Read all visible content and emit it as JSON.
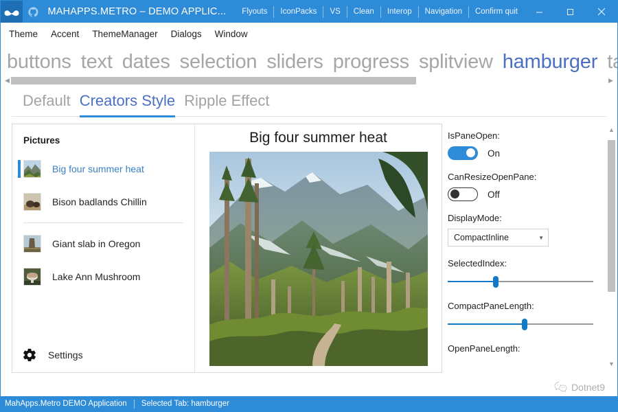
{
  "titlebar": {
    "logo_icon": "mustache-icon",
    "github_icon": "github-icon",
    "title": "MAHAPPS.METRO – DEMO APPLIC...",
    "menu_items": [
      "Flyouts",
      "IconPacks",
      "VS",
      "Clean",
      "Interop",
      "Navigation",
      "Confirm quit"
    ],
    "minimize": "–",
    "maximize": "▢",
    "close": "✕",
    "bg_color": "#2e8bd8"
  },
  "menubar": {
    "items": [
      "Theme",
      "Accent",
      "ThemeManager",
      "Dialogs",
      "Window"
    ]
  },
  "tabs": {
    "items": [
      {
        "label": "buttons",
        "active": false
      },
      {
        "label": "text",
        "active": false
      },
      {
        "label": "dates",
        "active": false
      },
      {
        "label": "selection",
        "active": false
      },
      {
        "label": "sliders",
        "active": false
      },
      {
        "label": "progress",
        "active": false
      },
      {
        "label": "splitview",
        "active": false
      },
      {
        "label": "hamburger",
        "active": true
      },
      {
        "label": "tabcontrol",
        "active": false
      }
    ],
    "active_color": "#4a6fc4",
    "scroll_left_arrow": "◀",
    "scroll_right_arrow": "▶"
  },
  "subtabs": {
    "items": [
      {
        "label": "Default",
        "active": false
      },
      {
        "label": "Creators Style",
        "active": true
      },
      {
        "label": "Ripple Effect",
        "active": false
      }
    ],
    "underline_color": "#2e8bd8"
  },
  "pane": {
    "title": "Pictures",
    "items": [
      {
        "label": "Big four summer heat",
        "selected": true
      },
      {
        "label": "Bison badlands Chillin",
        "selected": false
      },
      {
        "label": "Giant slab in Oregon",
        "selected": false
      },
      {
        "label": "Lake Ann Mushroom",
        "selected": false
      }
    ],
    "settings": {
      "icon": "gear-icon",
      "label": "Settings"
    }
  },
  "detail": {
    "title": "Big four summer heat",
    "image_alt": "mountain-forest-photo"
  },
  "options": {
    "is_pane_open": {
      "label": "IsPaneOpen:",
      "state": "On",
      "on": true
    },
    "can_resize_open_pane": {
      "label": "CanResizeOpenPane:",
      "state": "Off",
      "on": false
    },
    "display_mode": {
      "label": "DisplayMode:",
      "value": "CompactInline",
      "arrow": "▼"
    },
    "selected_index": {
      "label": "SelectedIndex:",
      "percent": 33
    },
    "compact_pane_length": {
      "label": "CompactPaneLength:",
      "percent": 53
    },
    "open_pane_length": {
      "label": "OpenPaneLength:"
    },
    "scroll_up_arrow": "▲",
    "scroll_down_arrow": "▼"
  },
  "watermark": {
    "icon": "wechat-icon",
    "text": "Dotnet9"
  },
  "statusbar": {
    "app_text": "MahApps.Metro DEMO Application",
    "tab_text": "Selected Tab:  hamburger"
  }
}
